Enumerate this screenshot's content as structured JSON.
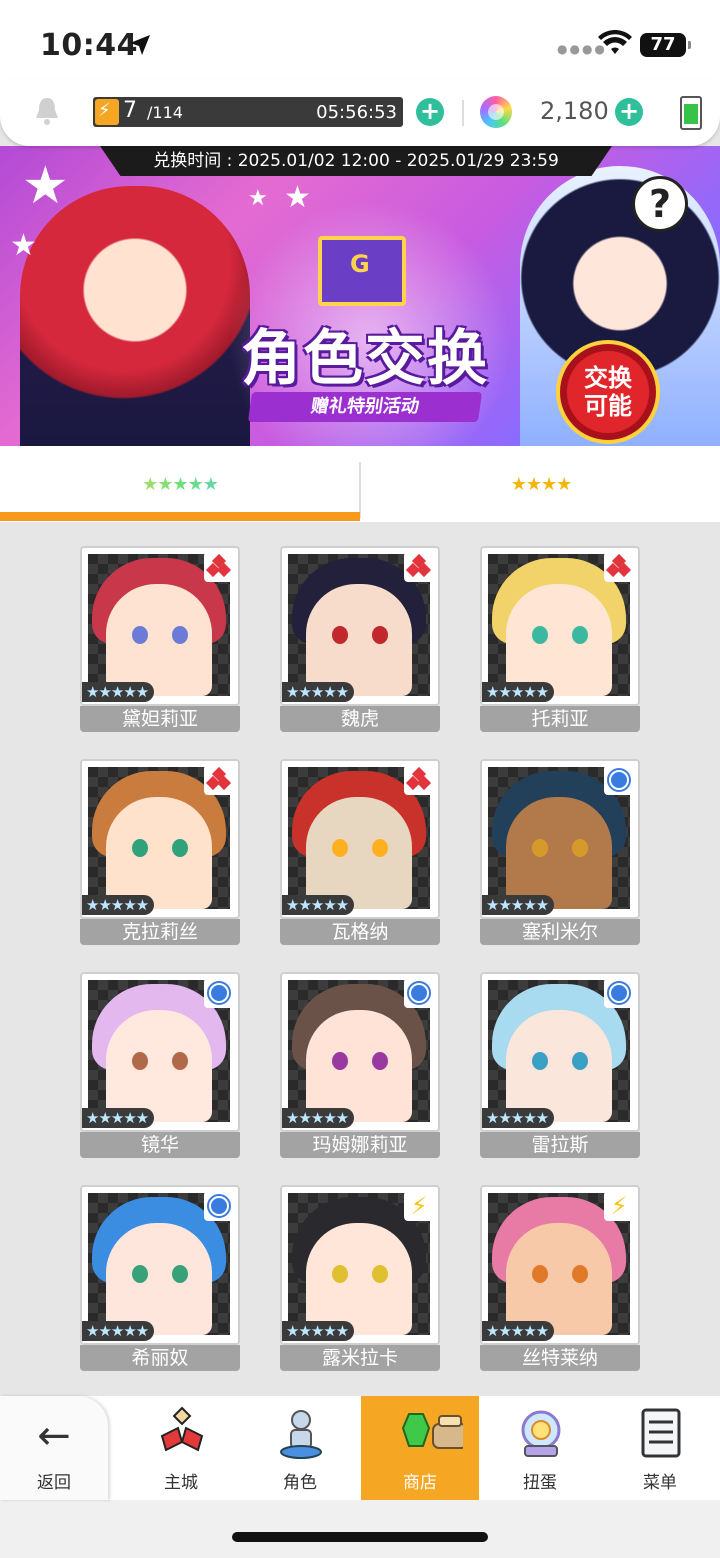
{
  "status_bar": {
    "time": "10:44",
    "battery": "77"
  },
  "resources": {
    "energy_current": "7",
    "energy_max": "/114",
    "energy_timer": "05:56:53",
    "gems": "2,180"
  },
  "banner": {
    "exchange_time": "兑换时间 : 2025.01/02 12:00 - 2025.01/29 23:59",
    "title": "角色交换",
    "subtitle": "赠礼特别活动",
    "badge_line1": "交换",
    "badge_line2": "可能",
    "help": "?"
  },
  "tabs": [
    {
      "stars": "★★★★★",
      "active": true
    },
    {
      "stars": "★★★★",
      "active": false
    }
  ],
  "characters": [
    {
      "name": "黛妲莉亚",
      "attr": "diamond",
      "stars": "★★★★★",
      "hair": "#c9374a",
      "skin": "#ffe3d2",
      "eye": "#6b7bd6"
    },
    {
      "name": "魏虎",
      "attr": "diamond",
      "stars": "★★★★★",
      "hair": "#22203a",
      "skin": "#f7dccb",
      "eye": "#c1272d"
    },
    {
      "name": "托莉亚",
      "attr": "diamond",
      "stars": "★★★★★",
      "hair": "#f2d36a",
      "skin": "#ffe6d4",
      "eye": "#3cb8a0"
    },
    {
      "name": "克拉莉丝",
      "attr": "diamond",
      "stars": "★★★★★",
      "hair": "#c97c3e",
      "skin": "#ffe2cc",
      "eye": "#2fa27a"
    },
    {
      "name": "瓦格纳",
      "attr": "diamond",
      "stars": "★★★★★",
      "hair": "#c8322a",
      "skin": "#e8d7c0",
      "eye": "#ffb020"
    },
    {
      "name": "塞利米尔",
      "attr": "circle",
      "stars": "★★★★★",
      "hair": "#23405a",
      "skin": "#b27a4a",
      "eye": "#d69a2a"
    },
    {
      "name": "镜华",
      "attr": "circle",
      "stars": "★★★★★",
      "hair": "#e2b8ef",
      "skin": "#ffe9df",
      "eye": "#b06a4a"
    },
    {
      "name": "玛姆娜莉亚",
      "attr": "circle",
      "stars": "★★★★★",
      "hair": "#6b5248",
      "skin": "#ffe3d6",
      "eye": "#9a3aa0"
    },
    {
      "name": "雷拉斯",
      "attr": "circle",
      "stars": "★★★★★",
      "hair": "#a8dbef",
      "skin": "#fbe6db",
      "eye": "#3aa0c4"
    },
    {
      "name": "希丽奴",
      "attr": "circle",
      "stars": "★★★★★",
      "hair": "#3a8de0",
      "skin": "#ffe6dc",
      "eye": "#3aa07a"
    },
    {
      "name": "露米拉卡",
      "attr": "bolt",
      "stars": "★★★★★",
      "hair": "#2a2a2e",
      "skin": "#ffe6d8",
      "eye": "#e0c030"
    },
    {
      "name": "丝特莱纳",
      "attr": "bolt",
      "stars": "★★★★★",
      "hair": "#e87aa6",
      "skin": "#f7c9a8",
      "eye": "#e07a2a"
    }
  ],
  "nav": [
    {
      "label": "返回",
      "icon": "back-arrow-icon"
    },
    {
      "label": "主城",
      "icon": "castle-icon"
    },
    {
      "label": "角色",
      "icon": "character-icon"
    },
    {
      "label": "商店",
      "icon": "shop-icon",
      "active": true
    },
    {
      "label": "扭蛋",
      "icon": "gacha-icon"
    },
    {
      "label": "菜单",
      "icon": "menu-icon"
    }
  ]
}
